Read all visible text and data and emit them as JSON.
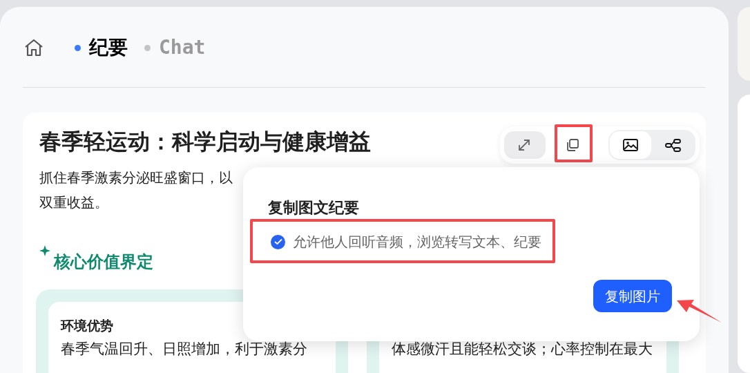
{
  "tabs": [
    {
      "label": "纪要",
      "selected": true
    },
    {
      "label": "Chat",
      "selected": false
    }
  ],
  "card": {
    "title": "春季轻运动：科学启动与健康增益",
    "intro_lines": [
      "抓住春季激素分泌旺盛窗口，以",
      "双重收益。"
    ],
    "section_heading": "核心价值界定",
    "panels": [
      {
        "title": "环境优势",
        "text": "春季气温回升、日照增加，利于激素分"
      },
      {
        "text": "体感微汗且能轻松交谈；心率控制在最大"
      }
    ]
  },
  "toolbar": [
    {
      "kind": "expand",
      "selected": false
    },
    {
      "kind": "copy",
      "selected": false
    },
    {
      "kind": "image",
      "selected": true
    },
    {
      "kind": "mindmap",
      "selected": false
    }
  ],
  "popup": {
    "title": "复制图文纪要",
    "option": {
      "label": "允许他人回听音频，浏览转写文本、纪要",
      "checked": true
    },
    "button": "复制图片"
  }
}
